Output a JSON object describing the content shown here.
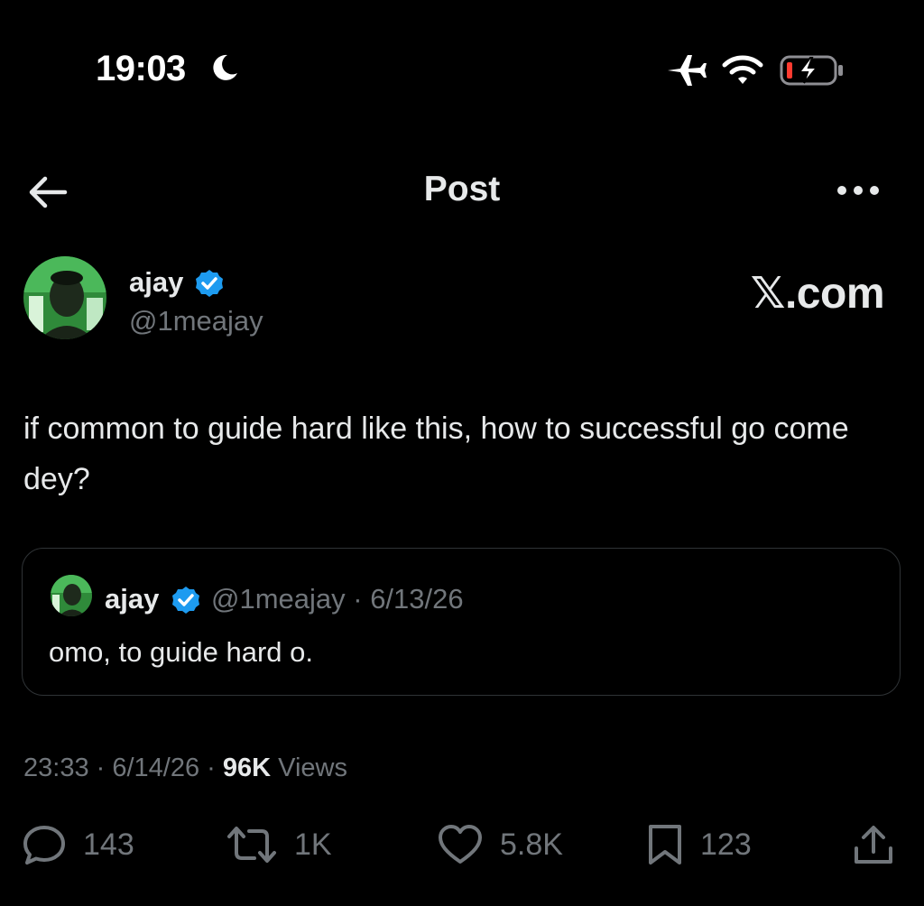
{
  "status_bar": {
    "time": "19:03",
    "icons": [
      "moon-icon",
      "airplane-icon",
      "wifi-icon",
      "battery-charging-icon"
    ]
  },
  "nav": {
    "title": "Post",
    "icons": [
      "back-arrow-icon",
      "more-icon"
    ]
  },
  "author": {
    "name": "ajay",
    "handle": "@1meajay",
    "verified": true
  },
  "watermark": "𝕏.com",
  "post": {
    "text": "if common to guide hard like this, how to successful go come dey?"
  },
  "quoted_post": {
    "name": "ajay",
    "handle_date": "@1meajay · 6/13/26",
    "text": "omo, to guide hard o."
  },
  "meta": {
    "time_date": "23:33 · 6/14/26 ·",
    "views_count": "96K",
    "views_label": "Views"
  },
  "actions": {
    "replies": "143",
    "reposts": "1K",
    "likes": "5.8K",
    "bookmarks": "123"
  },
  "colors": {
    "background": "#000000",
    "text": "#e7e9ea",
    "secondary": "#71767b",
    "verified": "#1d9bf0",
    "border": "#2f3336",
    "battery_low": "#ff3b30"
  }
}
